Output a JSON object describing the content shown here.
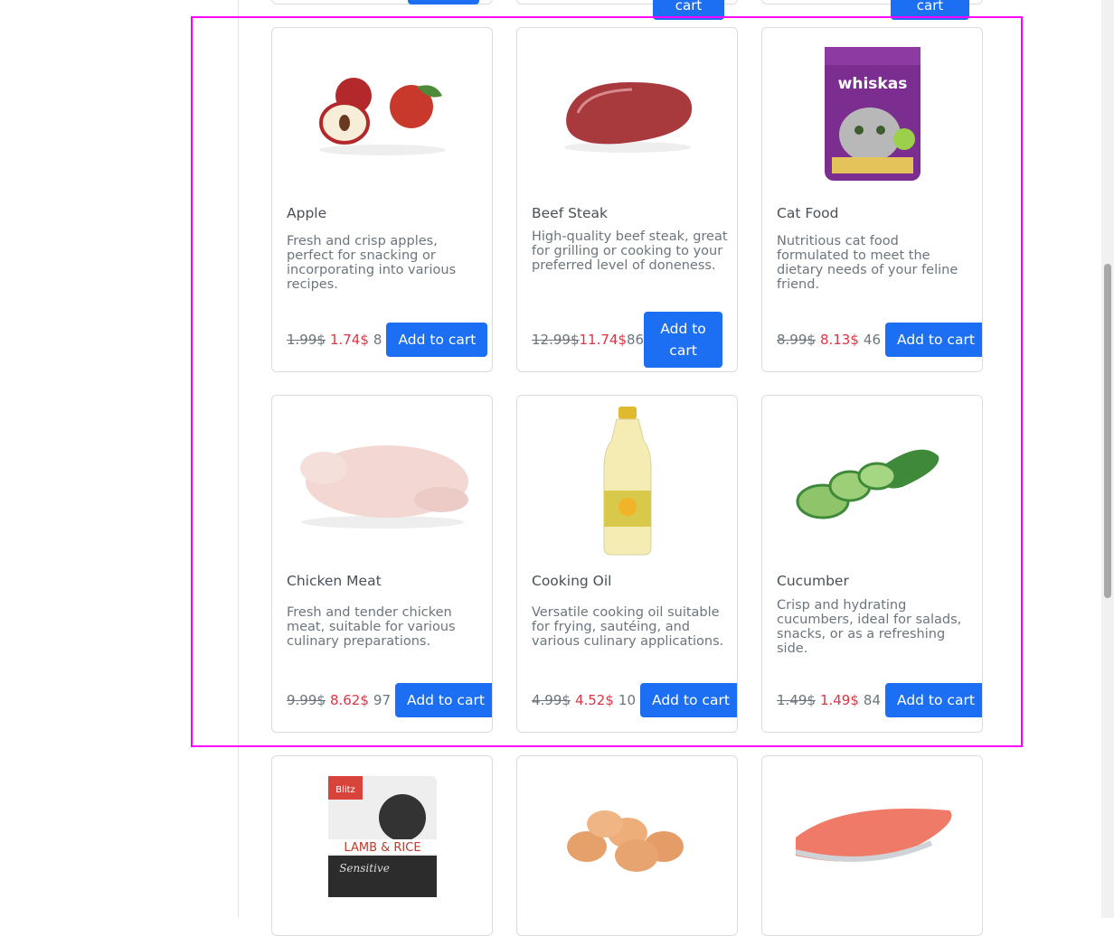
{
  "top_row": {
    "cart_label": "cart"
  },
  "products": [
    {
      "name": "Apple",
      "description": "Fresh and crisp apples, perfect for snacking or incorporating into various recipes.",
      "old_price": "1.99$",
      "new_price": "1.74$",
      "stock": "8",
      "button": "Add to cart",
      "image": "apple-image"
    },
    {
      "name": "Beef Steak",
      "description": "High-quality beef steak, great for grilling or cooking to your preferred level of doneness.",
      "old_price": "12.99$",
      "new_price": "11.74$",
      "stock": "86",
      "button": "Add to cart",
      "image": "steak-image"
    },
    {
      "name": "Cat Food",
      "description": "Nutritious cat food formulated to meet the dietary needs of your feline friend.",
      "old_price": "8.99$",
      "new_price": "8.13$",
      "stock": "46",
      "button": "Add to cart",
      "image": "cat-food-image",
      "brand": "whiskas"
    },
    {
      "name": "Chicken Meat",
      "description": "Fresh and tender chicken meat, suitable for various culinary preparations.",
      "old_price": "9.99$",
      "new_price": "8.62$",
      "stock": "97",
      "button": "Add to cart",
      "image": "chicken-image"
    },
    {
      "name": "Cooking Oil",
      "description": "Versatile cooking oil suitable for frying, sautéing, and various culinary applications.",
      "old_price": "4.99$",
      "new_price": "4.52$",
      "stock": "10",
      "button": "Add to cart",
      "image": "oil-image"
    },
    {
      "name": "Cucumber",
      "description": "Crisp and hydrating cucumbers, ideal for salads, snacks, or as a refreshing side.",
      "old_price": "1.49$",
      "new_price": "1.49$",
      "stock": "84",
      "button": "Add to cart",
      "image": "cucumber-image"
    }
  ],
  "bottom_row": [
    {
      "image": "dog-food-image",
      "label_top": "Blitz",
      "label_main": "LAMB & RICE",
      "label_sub": "Sensitive"
    },
    {
      "image": "eggs-image"
    },
    {
      "image": "salmon-image"
    }
  ]
}
